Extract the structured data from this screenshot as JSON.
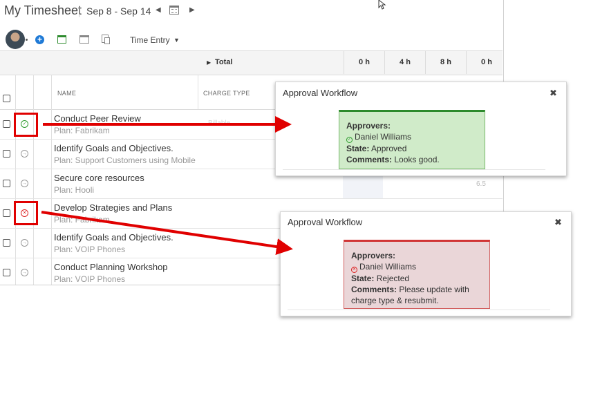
{
  "header": {
    "title": "My Timesheet",
    "date_range": "Sep 8 - Sep 14",
    "prev_glyph": "◀",
    "next_glyph": "▶"
  },
  "toolbar": {
    "add_glyph": "+",
    "entry_select": "Time Entry",
    "entry_caret": "▼"
  },
  "totals": {
    "label": "Total",
    "label_glyph": "▶",
    "days": [
      "0 h",
      "4 h",
      "8 h",
      "0 h"
    ]
  },
  "columns": {
    "name": "NAME",
    "charge_type": "CHARGE TYPE"
  },
  "rows": [
    {
      "name": "Conduct Peer Review",
      "plan": "Plan: Fabrikam",
      "status": "approved",
      "charge_ghost": "Billable"
    },
    {
      "name": "Identify Goals and Objectives.",
      "plan": "Plan: Support Customers using Mobile",
      "status": "pending"
    },
    {
      "name": "Secure core resources",
      "plan": "Plan: Hooli",
      "status": "pending",
      "value": "6.5"
    },
    {
      "name": "Develop Strategies and Plans",
      "plan": "Plan: Fabrikam",
      "status": "rejected"
    },
    {
      "name": "Identify Goals and Objectives.",
      "plan": "Plan: VOIP Phones",
      "status": "pending"
    },
    {
      "name": "Conduct Planning Workshop",
      "plan": "Plan: VOIP Phones",
      "status": "pending"
    }
  ],
  "status_glyphs": {
    "approved": "✓",
    "pending": "→",
    "rejected": "✕"
  },
  "popups": [
    {
      "title": "Approval Workflow",
      "close": "✖",
      "approvers_label": "Approvers:",
      "approver": "Daniel Williams",
      "state_label": "State:",
      "state": "Approved",
      "comments_label": "Comments:",
      "comments": "Looks good."
    },
    {
      "title": "Approval Workflow",
      "close": "✖",
      "approvers_label": "Approvers:",
      "approver": "Daniel Williams",
      "state_label": "State:",
      "state": "Rejected",
      "comments_label": "Comments:",
      "comments": "Please update with charge type & resubmit."
    }
  ],
  "colors": {
    "approved": "#2b9a2b",
    "rejected": "#d22222",
    "highlight": "#e00000",
    "accent": "#1f7ad6"
  }
}
